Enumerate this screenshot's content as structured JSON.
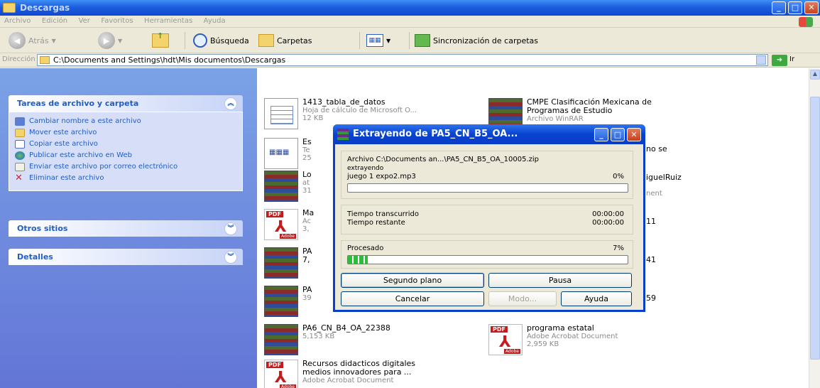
{
  "window": {
    "title": "Descargas"
  },
  "menu": [
    "Archivo",
    "Edición",
    "Ver",
    "Favoritos",
    "Herramientas",
    "Ayuda"
  ],
  "toolbar": {
    "back": "Atrás",
    "search": "Búsqueda",
    "folders": "Carpetas",
    "sync": "Sincronización de carpetas"
  },
  "address": {
    "label": "Dirección",
    "path": "C:\\Documents and Settings\\hdt\\Mis documentos\\Descargas",
    "go": "Ir"
  },
  "sidebar": {
    "tasks_title": "Tareas de archivo y carpeta",
    "tasks": [
      {
        "label": "Cambiar nombre a este archivo",
        "icon": "rename-icon"
      },
      {
        "label": "Mover este archivo",
        "icon": "move-icon"
      },
      {
        "label": "Copiar este archivo",
        "icon": "copy-icon"
      },
      {
        "label": "Publicar este archivo en Web",
        "icon": "publish-web-icon"
      },
      {
        "label": "Enviar este archivo por correo electrónico",
        "icon": "email-icon"
      },
      {
        "label": "Eliminar este archivo",
        "icon": "delete-icon"
      }
    ],
    "other_places": "Otros sitios",
    "details": "Detalles"
  },
  "files": [
    {
      "name": "1413_tabla_de_datos",
      "line2": "Hoja de cálculo de Microsoft O...",
      "line3": "12 KB",
      "type": "xls"
    },
    {
      "name": "CMPE Clasificación Mexicana de",
      "line2": "Programas de Estudio",
      "line3": "Archivo WinRAR",
      "type": "rar"
    },
    {
      "name": "Es",
      "line2": "Te",
      "line3": "25",
      "type": "doc"
    },
    {
      "name": "Lo",
      "line2": "at",
      "line3": "31",
      "type": "rar"
    },
    {
      "name": "Ma",
      "line2": "Ac",
      "line3": "3,",
      "type": "pdf"
    },
    {
      "name": "PA",
      "line2": "7,",
      "line3": "",
      "type": "rar"
    },
    {
      "name": "PA",
      "line2": "39",
      "line3": "",
      "type": "rar"
    },
    {
      "name": "PA6_CN_B4_OA_22388",
      "line2": "5,153 KB",
      "line3": "",
      "type": "rar"
    },
    {
      "name": "programa estatal",
      "line2": "Adobe Acrobat Document",
      "line3": "2,959 KB",
      "type": "pdf"
    },
    {
      "name": "Recursos didacticos digitales",
      "line2": "medios innovadores para ...",
      "line3": "Adobe Acrobat Document",
      "type": "pdf"
    }
  ],
  "partial": {
    "r2": "no se",
    "r3a": "iguelRuiz",
    "r3b": "nent",
    "r4": "11",
    "r5": "41",
    "r6": "59"
  },
  "dialog": {
    "title": "Extrayendo de PA5_CN_B5_OA...",
    "archive_line": "Archivo C:\\Documents an...\\PA5_CN_B5_OA_10005.zip",
    "extracting": "extrayendo",
    "current_file": "juego 1 expo2.mp3",
    "file_percent_label": "0%",
    "file_progress": 0,
    "elapsed_label": "Tiempo transcurrido",
    "elapsed_value": "00:00:00",
    "remaining_label": "Tiempo restante",
    "remaining_value": "00:00:00",
    "processed_label": "Procesado",
    "processed_percent_label": "7%",
    "processed_progress": 0.07,
    "btn_background": "Segundo plano",
    "btn_pause": "Pausa",
    "btn_cancel": "Cancelar",
    "btn_mode": "Modo...",
    "btn_help": "Ayuda"
  }
}
